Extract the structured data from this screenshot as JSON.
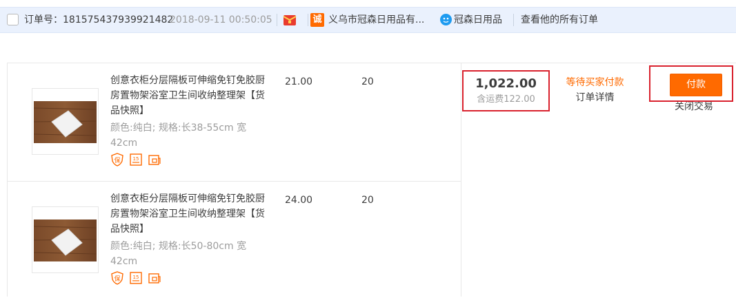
{
  "header": {
    "order_label": "订单号：181575437939921482",
    "order_time": "2018-09-11 00:50:05",
    "shop_icon_char": "诚",
    "shop_name": "义乌市冠森日用品有...",
    "seller_name": "冠森日用品",
    "view_all": "查看他的所有订单"
  },
  "items": [
    {
      "title": "创意衣柜分层隔板可伸缩免钉免胶厨房置物架浴室卫生间收纳整理架",
      "snapshot": "【货品快照】",
      "attrs": "颜色:纯白; 规格:长38-55cm 宽42cm",
      "price": "21.00",
      "quantity": "20"
    },
    {
      "title": "创意衣柜分层隔板可伸缩免钉免胶厨房置物架浴室卫生间收纳整理架",
      "snapshot": "【货品快照】",
      "attrs": "颜色:纯白; 规格:长50-80cm 宽42cm",
      "price": "24.00",
      "quantity": "20"
    }
  ],
  "total": {
    "amount": "1,022.00",
    "shipping": "含运费122.00"
  },
  "status": {
    "text": "等待买家付款",
    "detail": "订单详情"
  },
  "actions": {
    "pay": "付款",
    "close": "关闭交易"
  },
  "colors": {
    "accent": "#ff6a00",
    "highlight_border": "#d9212d",
    "header_bg": "#eaf1fd",
    "muted_text": "#9c9c9c"
  },
  "icons": {
    "order_checkbox": "checkbox-icon",
    "red_envelope": "red-envelope-icon",
    "shop": "shop-cheng-icon",
    "chat": "wangwang-chat-icon",
    "badge_guarantee": "guarantee-icon",
    "badge_15day": "fifteen-day-icon",
    "badge_refund": "refund-icon"
  }
}
